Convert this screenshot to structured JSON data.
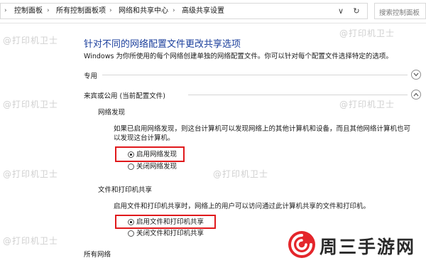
{
  "addressbar": {
    "breadcrumbs": [
      "控制面板",
      "所有控制面板项",
      "网络和共享中心",
      "高级共享设置"
    ],
    "dropdown_glyph": "∨",
    "refresh_glyph": "↻",
    "search_placeholder": "搜索控制面板"
  },
  "page": {
    "title": "针对不同的网络配置文件更改共享选项",
    "description": "Windows 为你所使用的每个网络创建单独的网络配置文件。你可以针对每个配置文件选择特定的选项。"
  },
  "profiles": {
    "private": {
      "label": "专用",
      "expanded": false
    },
    "guest": {
      "label": "来宾或公用 (当前配置文件)",
      "expanded": true
    },
    "all": {
      "label": "所有网络"
    }
  },
  "network_discovery": {
    "heading": "网络发现",
    "description": "如果已启用网络发现，则这台计算机可以发现网络上的其他计算机和设备，而且其他网络计算机也可以发现这台计算机。",
    "options": [
      {
        "label": "启用网络发现",
        "selected": true
      },
      {
        "label": "关闭网络发现",
        "selected": false
      }
    ]
  },
  "file_printer_sharing": {
    "heading": "文件和打印机共享",
    "description": "启用文件和打印机共享时，网络上的用户可以访问通过此计算机共享的文件和打印机。",
    "options": [
      {
        "label": "启用文件和打印机共享",
        "selected": true
      },
      {
        "label": "关闭文件和打印机共享",
        "selected": false
      }
    ]
  },
  "watermark": {
    "text": "@打印机卫士"
  },
  "logo": {
    "text": "周三手游网"
  },
  "colors": {
    "title": "#1b3f9c",
    "highlight": "#e0191c",
    "logo_red": "#e4262b"
  }
}
